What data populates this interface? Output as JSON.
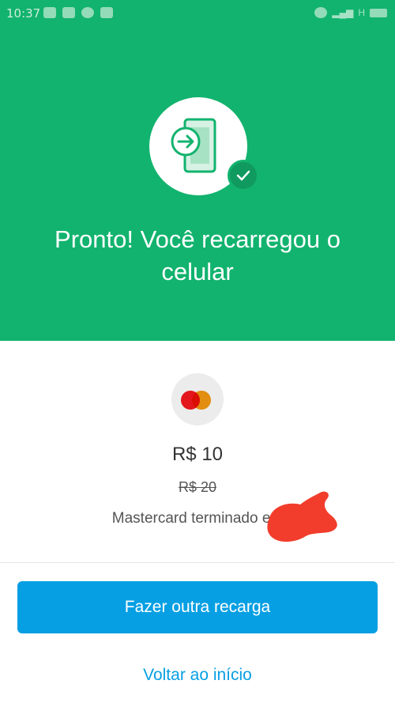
{
  "status_bar": {
    "time": "10:37",
    "network": "H"
  },
  "hero": {
    "title_line1": "Pronto! Você recarregou o",
    "title_line2": "celular",
    "background_color": "#12b36e"
  },
  "payment": {
    "card_brand_icon": "mastercard-icon",
    "amount": "R$ 10",
    "original_amount": "R$ 20",
    "card_text": "Mastercard terminado em"
  },
  "actions": {
    "primary_label": "Fazer outra recarga",
    "secondary_label": "Voltar ao início",
    "accent_color": "#079fe3"
  }
}
